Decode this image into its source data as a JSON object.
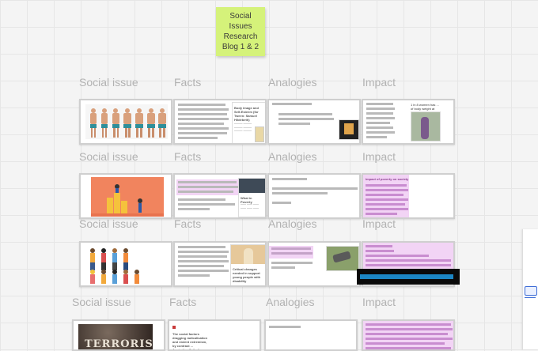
{
  "sticky": {
    "text": "Social Issues Research Blog 1 & 2"
  },
  "columns": [
    "Social issue",
    "Facts",
    "Analogies",
    "Impact"
  ],
  "cards": {
    "r1_facts_caption": "Body image and Self-Esteem (for Tween: Samuel Hildebeth)",
    "r1_impact_caption": "1 in 8 women has ... of body weight at once",
    "r2_facts_caption": "What in Poverty",
    "r2_impact_caption": "Impact of poverty on society",
    "r3_facts_caption": "Critical changes needed in support young people with disability",
    "r4_issue_image_text": "TERRORISM",
    "r4_facts_caption": "The social factors dragging radicalisation and violent extremism, by contrast ... Australian Catholic University"
  }
}
